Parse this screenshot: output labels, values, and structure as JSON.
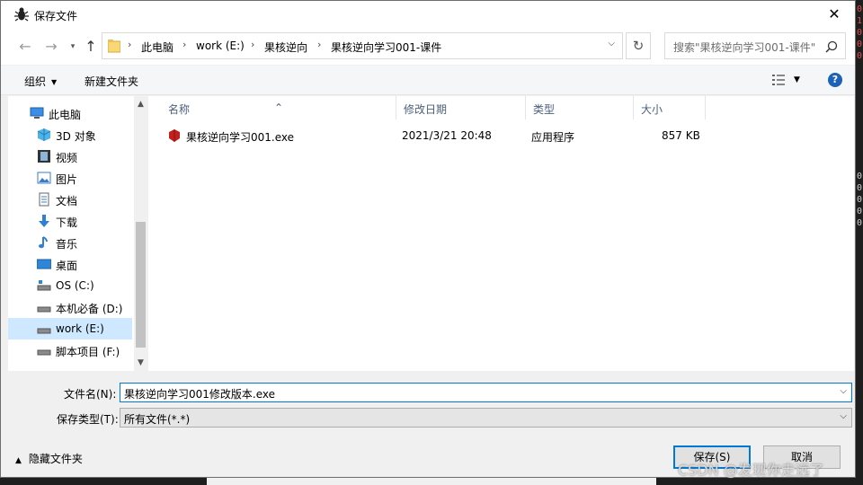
{
  "window": {
    "title": "保存文件",
    "close_glyph": "✕"
  },
  "nav": {
    "back_glyph": "←",
    "forward_glyph": "→",
    "up_glyph": "↑",
    "breadcrumbs": [
      "此电脑",
      "work (E:)",
      "果核逆向",
      "果核逆向学习001-课件"
    ],
    "refresh_glyph": "↻",
    "search_placeholder": "搜索\"果核逆向学习001-课件\""
  },
  "toolbar": {
    "organize": "组织",
    "new_folder": "新建文件夹",
    "help": "?"
  },
  "sidebar": {
    "items": [
      {
        "label": "此电脑",
        "icon": "computer-icon"
      },
      {
        "label": "3D 对象",
        "icon": "3d-objects-icon"
      },
      {
        "label": "视频",
        "icon": "video-icon"
      },
      {
        "label": "图片",
        "icon": "pictures-icon"
      },
      {
        "label": "文档",
        "icon": "documents-icon"
      },
      {
        "label": "下载",
        "icon": "downloads-icon"
      },
      {
        "label": "音乐",
        "icon": "music-icon"
      },
      {
        "label": "桌面",
        "icon": "desktop-icon"
      },
      {
        "label": "OS (C:)",
        "icon": "drive-icon"
      },
      {
        "label": "本机必备 (D:)",
        "icon": "drive-icon"
      },
      {
        "label": "work (E:)",
        "icon": "drive-icon",
        "selected": true
      },
      {
        "label": "脚本项目 (F:)",
        "icon": "drive-icon"
      }
    ]
  },
  "filelist": {
    "columns": [
      "名称",
      "修改日期",
      "类型",
      "大小"
    ],
    "files": [
      {
        "name": "果核逆向学习001.exe",
        "modified": "2021/3/21 20:48",
        "type": "应用程序",
        "size": "857 KB"
      }
    ]
  },
  "form": {
    "filename_label": "文件名(N):",
    "filename_value": "果核逆向学习001修改版本.exe",
    "filetype_label": "保存类型(T):",
    "filetype_value": "所有文件(*.*)"
  },
  "footer": {
    "hide_folders": "隐藏文件夹",
    "save_button": "保存(S)",
    "cancel_button": "取消",
    "watermark": "CSDN @发现你走远了"
  },
  "background": {
    "digits": [
      "0",
      "1",
      "0",
      "0",
      "0"
    ],
    "digits_mid": [
      "0",
      "0",
      "0",
      "0",
      "0"
    ],
    "digit_color": "#e05050"
  },
  "colors": {
    "accent": "#0078d7",
    "selection": "#cde8ff",
    "header_text": "#4c607a"
  }
}
